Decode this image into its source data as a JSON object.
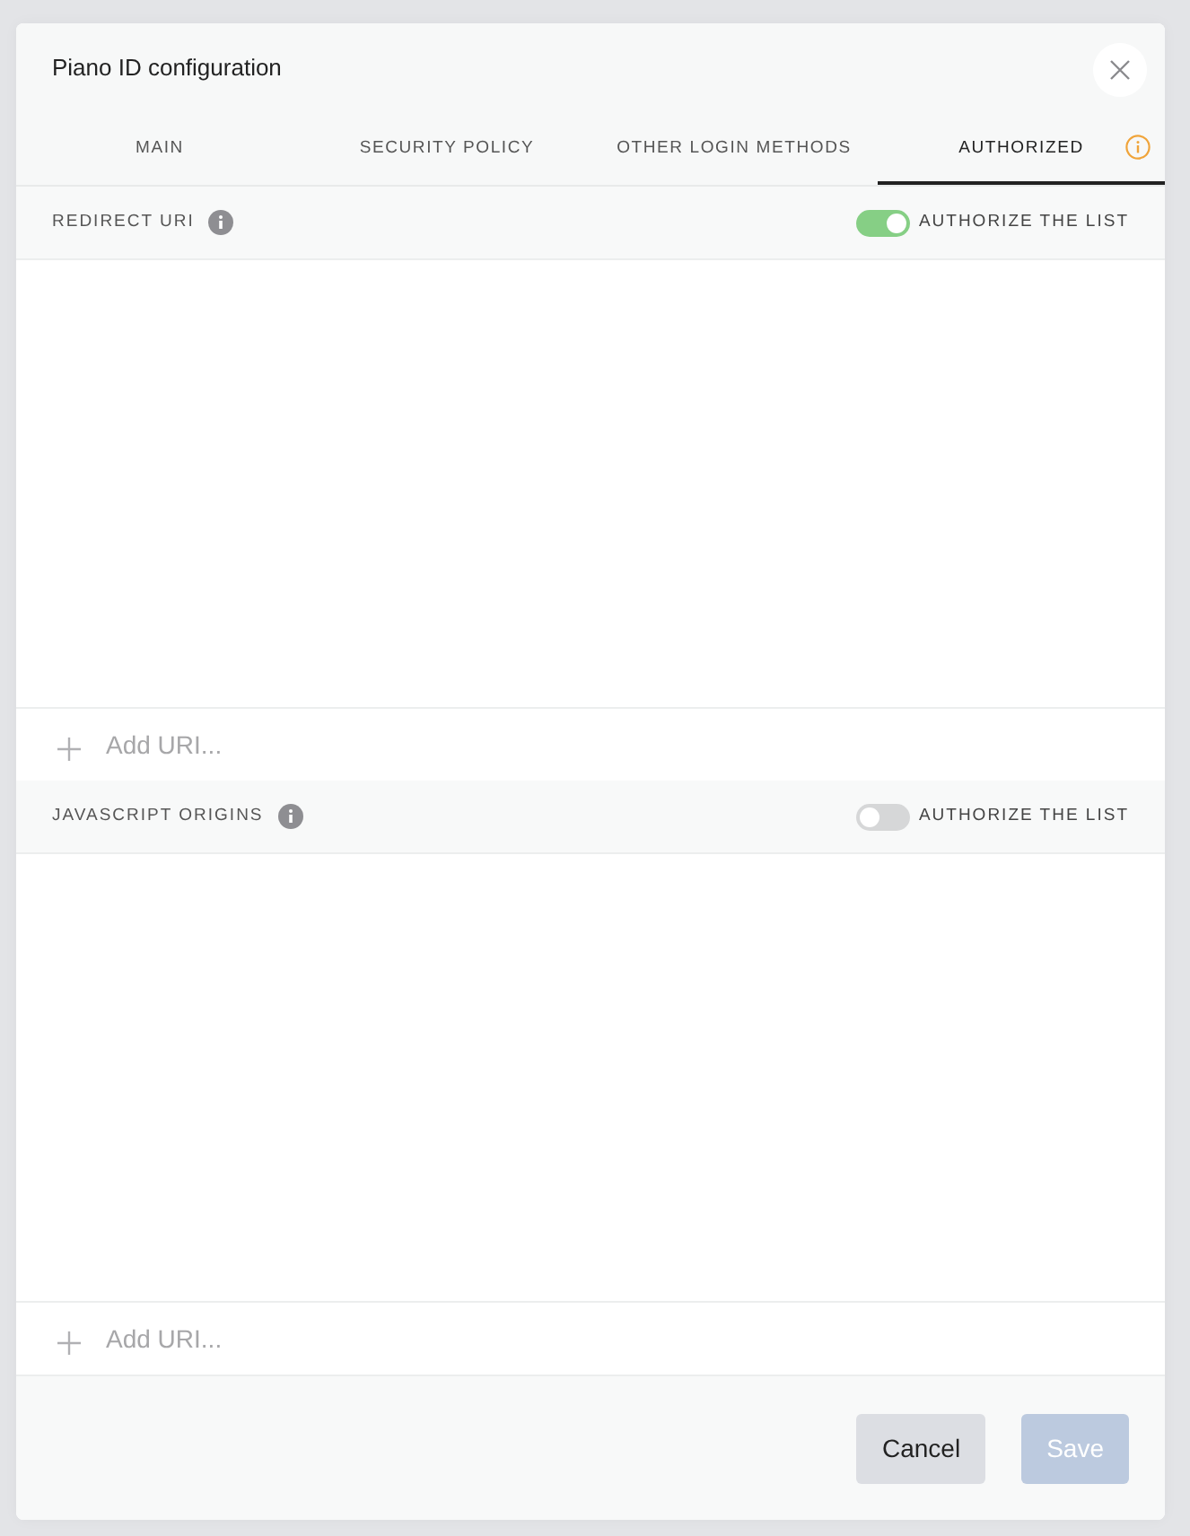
{
  "dialog": {
    "title": "Piano ID configuration"
  },
  "tabs": [
    {
      "label": "MAIN",
      "selected": false,
      "info_icon": false
    },
    {
      "label": "SECURITY POLICY",
      "selected": false,
      "info_icon": false
    },
    {
      "label": "OTHER LOGIN METHODS",
      "selected": false,
      "info_icon": false
    },
    {
      "label": "AUTHORIZED",
      "selected": true,
      "info_icon": true
    }
  ],
  "sections": [
    {
      "title": "REDIRECT URI",
      "toggle": {
        "label": "AUTHORIZE THE LIST",
        "on": true
      },
      "add_field": {
        "placeholder": "Add URI..."
      }
    },
    {
      "title": "JAVASCRIPT ORIGINS",
      "toggle": {
        "label": "AUTHORIZE THE LIST",
        "on": false
      },
      "add_field": {
        "placeholder": "Add URI..."
      }
    }
  ],
  "buttons": [
    {
      "label": "Cancel",
      "kind": "secondary",
      "disabled": false
    },
    {
      "label": "Save",
      "kind": "primary",
      "disabled": true
    }
  ]
}
